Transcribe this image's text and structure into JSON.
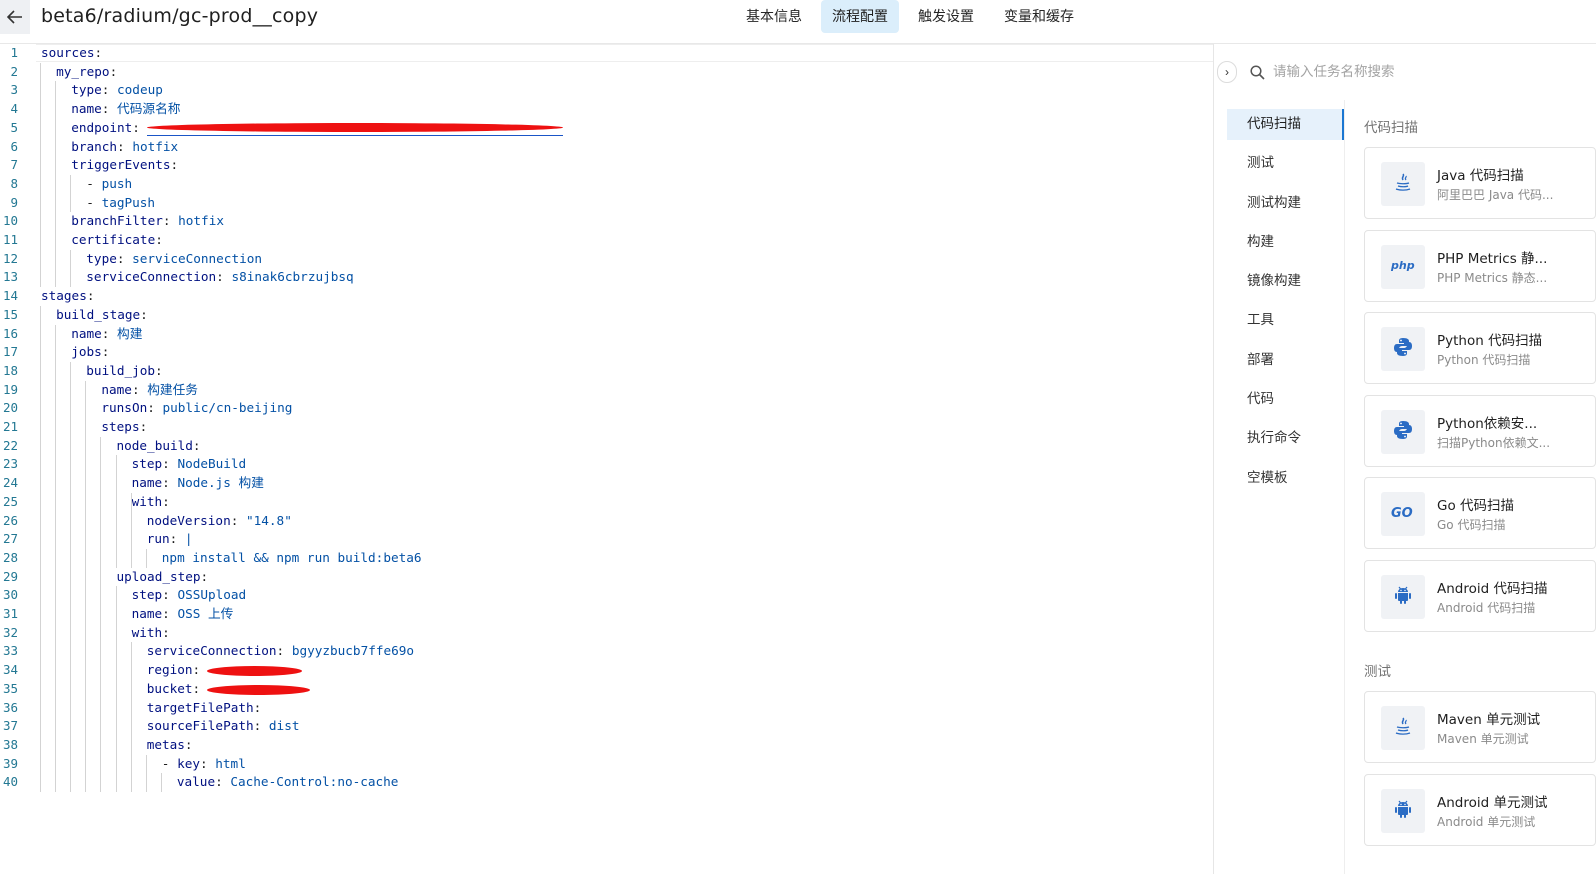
{
  "header": {
    "title": "beta6/radium/gc-prod__copy",
    "tabs": [
      {
        "label": "基本信息",
        "active": false
      },
      {
        "label": "流程配置",
        "active": true
      },
      {
        "label": "触发设置",
        "active": false
      },
      {
        "label": "变量和缓存",
        "active": false
      }
    ]
  },
  "editor": {
    "lines": [
      {
        "n": "1",
        "indent": 0,
        "key": "sources",
        "sep": ":",
        "val": ""
      },
      {
        "n": "2",
        "indent": 2,
        "key": "my_repo",
        "sep": ":",
        "val": ""
      },
      {
        "n": "3",
        "indent": 4,
        "key": "type",
        "sep": ": ",
        "val": "codeup"
      },
      {
        "n": "4",
        "indent": 4,
        "key": "name",
        "sep": ": ",
        "val": "代码源名称"
      },
      {
        "n": "5",
        "indent": 4,
        "key": "endpoint",
        "sep": ": ",
        "val": ""
      },
      {
        "n": "6",
        "indent": 4,
        "key": "branch",
        "sep": ": ",
        "val": "hotfix"
      },
      {
        "n": "7",
        "indent": 4,
        "key": "triggerEvents",
        "sep": ":",
        "val": ""
      },
      {
        "n": "8",
        "indent": 6,
        "key": "",
        "sep": "- ",
        "val": "push"
      },
      {
        "n": "9",
        "indent": 6,
        "key": "",
        "sep": "- ",
        "val": "tagPush"
      },
      {
        "n": "10",
        "indent": 4,
        "key": "branchFilter",
        "sep": ": ",
        "val": "hotfix"
      },
      {
        "n": "11",
        "indent": 4,
        "key": "certificate",
        "sep": ":",
        "val": ""
      },
      {
        "n": "12",
        "indent": 6,
        "key": "type",
        "sep": ": ",
        "val": "serviceConnection"
      },
      {
        "n": "13",
        "indent": 6,
        "key": "serviceConnection",
        "sep": ": ",
        "val": "s8inak6cbrzujbsq"
      },
      {
        "n": "14",
        "indent": 0,
        "key": "stages",
        "sep": ":",
        "val": ""
      },
      {
        "n": "15",
        "indent": 2,
        "key": "build_stage",
        "sep": ":",
        "val": ""
      },
      {
        "n": "16",
        "indent": 4,
        "key": "name",
        "sep": ": ",
        "val": "构建"
      },
      {
        "n": "17",
        "indent": 4,
        "key": "jobs",
        "sep": ":",
        "val": ""
      },
      {
        "n": "18",
        "indent": 6,
        "key": "build_job",
        "sep": ":",
        "val": ""
      },
      {
        "n": "19",
        "indent": 8,
        "key": "name",
        "sep": ": ",
        "val": "构建任务"
      },
      {
        "n": "20",
        "indent": 8,
        "key": "runsOn",
        "sep": ": ",
        "val": "public/cn-beijing"
      },
      {
        "n": "21",
        "indent": 8,
        "key": "steps",
        "sep": ":",
        "val": ""
      },
      {
        "n": "22",
        "indent": 10,
        "key": "node_build",
        "sep": ":",
        "val": ""
      },
      {
        "n": "23",
        "indent": 12,
        "key": "step",
        "sep": ": ",
        "val": "NodeBuild"
      },
      {
        "n": "24",
        "indent": 12,
        "key": "name",
        "sep": ": ",
        "val": "Node.js 构建"
      },
      {
        "n": "25",
        "indent": 12,
        "key": "with",
        "sep": ":",
        "val": ""
      },
      {
        "n": "26",
        "indent": 14,
        "key": "nodeVersion",
        "sep": ": ",
        "val": "\"14.8\""
      },
      {
        "n": "27",
        "indent": 14,
        "key": "run",
        "sep": ": ",
        "val": "|"
      },
      {
        "n": "28",
        "indent": 16,
        "key": "",
        "sep": "",
        "val": "npm install && npm run build:beta6"
      },
      {
        "n": "29",
        "indent": 10,
        "key": "upload_step",
        "sep": ":",
        "val": ""
      },
      {
        "n": "30",
        "indent": 12,
        "key": "step",
        "sep": ": ",
        "val": "OSSUpload"
      },
      {
        "n": "31",
        "indent": 12,
        "key": "name",
        "sep": ": ",
        "val": "OSS 上传"
      },
      {
        "n": "32",
        "indent": 12,
        "key": "with",
        "sep": ":",
        "val": ""
      },
      {
        "n": "33",
        "indent": 14,
        "key": "serviceConnection",
        "sep": ": ",
        "val": "bgyyzbucb7ffe69o"
      },
      {
        "n": "34",
        "indent": 14,
        "key": "region",
        "sep": ": ",
        "val": ""
      },
      {
        "n": "35",
        "indent": 14,
        "key": "bucket",
        "sep": ": ",
        "val": ""
      },
      {
        "n": "36",
        "indent": 14,
        "key": "targetFilePath",
        "sep": ":",
        "val": ""
      },
      {
        "n": "37",
        "indent": 14,
        "key": "sourceFilePath",
        "sep": ": ",
        "val": "dist"
      },
      {
        "n": "38",
        "indent": 14,
        "key": "metas",
        "sep": ":",
        "val": ""
      },
      {
        "n": "39",
        "indent": 16,
        "key": "",
        "sep": "- ",
        "val": "",
        "key2": "key",
        "val2": "html"
      },
      {
        "n": "40",
        "indent": 18,
        "key": "value",
        "sep": ": ",
        "val": "Cache-Control:no-cache"
      }
    ]
  },
  "panel": {
    "search_placeholder": "请输入任务名称搜索",
    "categories": [
      {
        "label": "代码扫描",
        "active": true
      },
      {
        "label": "测试",
        "active": false
      },
      {
        "label": "测试构建",
        "active": false
      },
      {
        "label": "构建",
        "active": false
      },
      {
        "label": "镜像构建",
        "active": false
      },
      {
        "label": "工具",
        "active": false
      },
      {
        "label": "部署",
        "active": false
      },
      {
        "label": "代码",
        "active": false
      },
      {
        "label": "执行命令",
        "active": false
      },
      {
        "label": "空模板",
        "active": false
      }
    ],
    "sections": [
      {
        "title": "代码扫描",
        "cards": [
          {
            "name": "Java 代码扫描",
            "desc": "阿里巴巴 Java 代码...",
            "icon": "java-icon"
          },
          {
            "name": "PHP Metrics 静...",
            "desc": "PHP Metrics 静态...",
            "icon": "php-icon"
          },
          {
            "name": "Python 代码扫描",
            "desc": "Python 代码扫描",
            "icon": "python-icon"
          },
          {
            "name": "Python依赖安...",
            "desc": "扫描Python依赖文...",
            "icon": "python-icon"
          },
          {
            "name": "Go 代码扫描",
            "desc": "Go 代码扫描",
            "icon": "go-icon"
          },
          {
            "name": "Android 代码扫描",
            "desc": "Android 代码扫描",
            "icon": "android-icon"
          }
        ]
      },
      {
        "title": "测试",
        "cards": [
          {
            "name": "Maven 单元测试",
            "desc": "Maven 单元测试",
            "icon": "java-icon"
          },
          {
            "name": "Android 单元测试",
            "desc": "Android 单元测试",
            "icon": "android-icon"
          }
        ]
      }
    ]
  },
  "colors": {
    "accent": "#1b77d2",
    "active_tab_bg": "#dbeefb",
    "line_number": "#237893",
    "yaml_key": "#001080",
    "yaml_value": "#0451a5"
  }
}
